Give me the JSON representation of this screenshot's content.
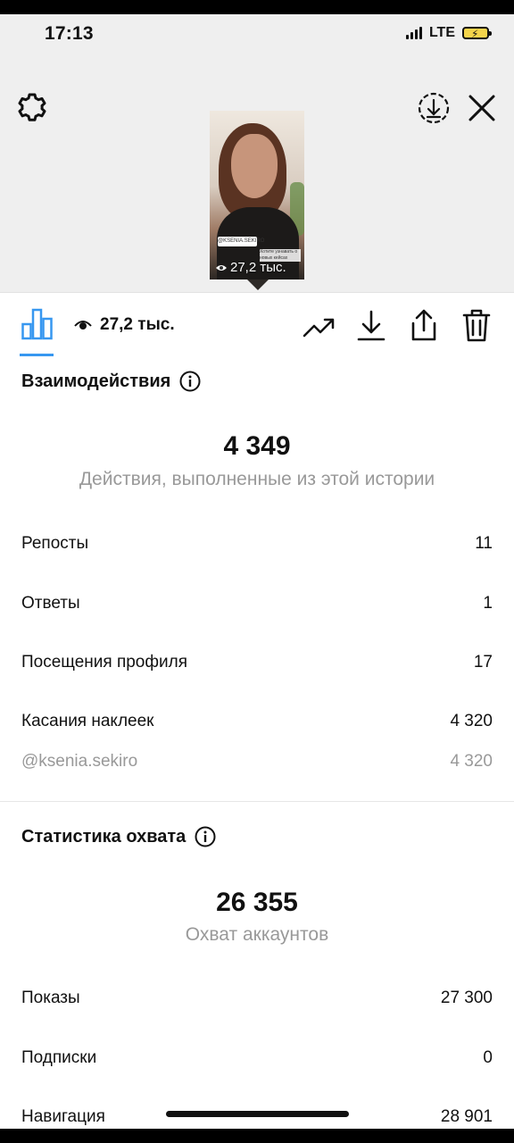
{
  "status_bar": {
    "time": "17:13",
    "network": "LTE"
  },
  "header": {
    "settings_icon": "gear-icon",
    "save_icon": "download-circle-icon",
    "close_icon": "close-icon",
    "thumbnail": {
      "views": "27,2 тыс.",
      "sticker_text": "@KSENIA.SEKIRO",
      "caption_text": "Хотите узнавать о новых кейсах каждый день, успех, доход, принципы на своей практике? Подписывайтесь"
    }
  },
  "toolbar": {
    "insights_icon": "bar-chart-icon",
    "views": "27,2 тыс.",
    "actions": [
      "promote-trend-icon",
      "download-icon",
      "share-icon",
      "trash-icon"
    ]
  },
  "interactions": {
    "title": "Взаимодействия",
    "total": "4 349",
    "subtitle": "Действия, выполненные из этой истории",
    "rows": [
      {
        "label": "Репосты",
        "value": "11"
      },
      {
        "label": "Ответы",
        "value": "1"
      },
      {
        "label": "Посещения профиля",
        "value": "17"
      },
      {
        "label": "Касания наклеек",
        "value": "4 320"
      },
      {
        "label": "@ksenia.sekiro",
        "value": "4 320"
      }
    ]
  },
  "reach": {
    "title": "Статистика охвата",
    "total": "26 355",
    "subtitle": "Охват аккаунтов",
    "rows": [
      {
        "label": "Показы",
        "value": "27 300"
      },
      {
        "label": "Подписки",
        "value": "0"
      },
      {
        "label": "Навигация",
        "value": "28 901"
      }
    ]
  },
  "colors": {
    "accent": "#3797f0",
    "header_bg": "#efefef",
    "muted_text": "#999999"
  }
}
